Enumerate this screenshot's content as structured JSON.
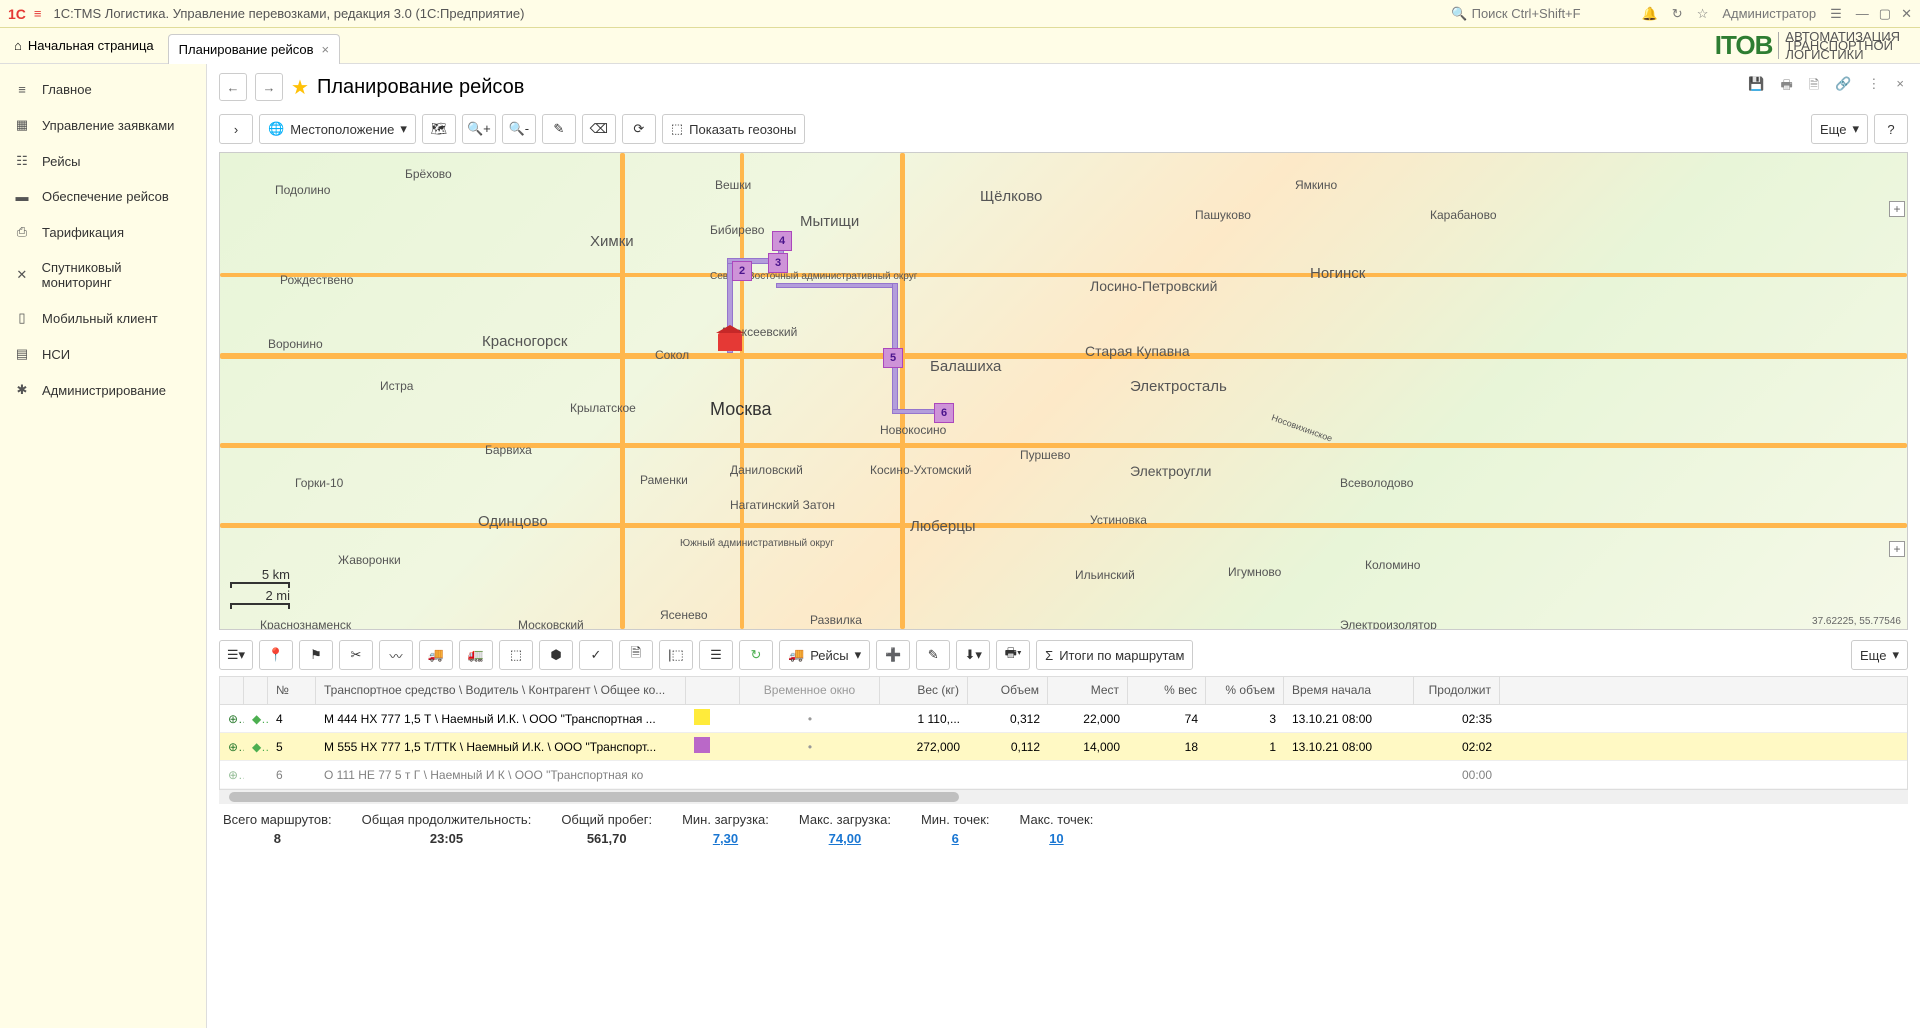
{
  "title": "1C:TMS Логистика. Управление перевозками, редакция 3.0  (1С:Предприятие)",
  "searchPlaceholder": "Поиск Ctrl+Shift+F",
  "user": "Администратор",
  "brand": {
    "main": "ITOB",
    "sub1": "АВТОМАТИЗАЦИЯ",
    "sub2": "ТРАНСПОРТНОЙ",
    "sub3": "ЛОГИСТИКИ"
  },
  "tabs": {
    "home": "Начальная страница",
    "active": "Планирование рейсов"
  },
  "nav": [
    "Главное",
    "Управление заявками",
    "Рейсы",
    "Обеспечение рейсов",
    "Тарификация",
    "Спутниковый мониторинг",
    "Мобильный клиент",
    "НСИ",
    "Администрирование"
  ],
  "navIcons": [
    "≡",
    "▦",
    "☷",
    "▬",
    "⎙",
    "✕",
    "▯",
    "▤",
    "✱"
  ],
  "page": {
    "title": "Планирование рейсов"
  },
  "tb1": {
    "location": "Местоположение",
    "geozones": "Показать геозоны",
    "more": "Еще",
    "help": "?"
  },
  "cities": {
    "moscow": "Москва",
    "podolino": "Подолино",
    "brekhovo": "Брёхово",
    "rozhdestveno": "Рождествено",
    "voronino": "Воронино",
    "istra": "Истра",
    "krasnogorsk": "Красногорск",
    "odintsovo": "Одинцово",
    "barvikha": "Барвиха",
    "krylatskoye": "Крылатское",
    "zhavoronki": "Жаворонки",
    "gorki": "Горки-10",
    "krasnoznamensk": "Краснознаменск",
    "moskovskiy": "Московский",
    "ramenki": "Раменки",
    "danilovskiy": "Даниловский",
    "nagatinsky": "Нагатинский Затон",
    "yuzhny": "Южный административный округ",
    "yasenevo": "Ясенево",
    "razvilka": "Развилка",
    "khimki": "Химки",
    "sokol": "Сокол",
    "biberevo": "Бибирево",
    "veshki": "Вешки",
    "mytishchi": "Мытищи",
    "alekseevsky": "Алексеевский",
    "vostochny": "Северо-Восточный административный округ",
    "balashikha": "Балашиха",
    "novokosino": "Новокосино",
    "lyubertsy": "Люберцы",
    "kosino": "Косино-Ухтомский",
    "shchelkovo": "Щёлково",
    "yamkino": "Ямкино",
    "pashukovo": "Пашуково",
    "losino": "Лосино-Петровский",
    "kupavna": "Старая Купавна",
    "elektrostal": "Электросталь",
    "elektrougli": "Электроугли",
    "ustinovka": "Устиновка",
    "ilinskiy": "Ильинский",
    "noginsk": "Ногинск",
    "karabanovo": "Карабаново",
    "igumnovo": "Игумново",
    "kolomino": "Коломино",
    "vsevolodovo": "Всеволодово",
    "nosovikh": "Носовихинское",
    "purshevo": "Пуршево",
    "elektroizol": "Электроизолятор"
  },
  "scale": {
    "km": "5 km",
    "mi": "2 mi"
  },
  "coords": "37.62225, 55.77546",
  "tb2": {
    "routes": "Рейсы",
    "totals": "Итоги по маршрутам",
    "more": "Еще"
  },
  "cols": {
    "no": "№",
    "ts": "Транспортное средство \\ Водитель \\ Контрагент \\ Общее ко...",
    "tw": "Временное окно",
    "wt": "Вес (кг)",
    "vol": "Объем",
    "pl": "Мест",
    "pw": "% вес",
    "pv": "% объем",
    "time": "Время начала",
    "dur": "Продолжит"
  },
  "rows": [
    {
      "no": "4",
      "ts": "М 444 НХ 777  1,5 Т  \\ Наемный И.К. \\ ООО \"Транспортная ...",
      "col": "#ffeb3b",
      "wt": "1 110,...",
      "vol": "0,312",
      "pl": "22,000",
      "pw": "74",
      "pv": "3",
      "time": "13.10.21 08:00",
      "dur": "02:35"
    },
    {
      "no": "5",
      "ts": "М 555 НХ 777  1,5 Т/ТТК \\ Наемный И.К. \\ ООО \"Транспорт...",
      "col": "#ba68c8",
      "wt": "272,000",
      "vol": "0,112",
      "pl": "14,000",
      "pw": "18",
      "pv": "1",
      "time": "13.10.21 08:00",
      "dur": "02:02"
    },
    {
      "no": "6",
      "ts": "О 111 НЕ 77 5 т  Г \\ Наемный И К \\ ООО \"Транспортная ко",
      "col": "",
      "wt": "",
      "vol": "",
      "pl": "",
      "pw": "",
      "pv": "",
      "time": "",
      "dur": "00:00"
    }
  ],
  "footer": {
    "l1": "Всего маршрутов:",
    "v1": "8",
    "l2": "Общая продолжительность:",
    "v2": "23:05",
    "l3": "Общий пробег:",
    "v3": "561,70",
    "l4": "Мин. загрузка:",
    "v4": "7,30",
    "l5": "Макс. загрузка:",
    "v5": "74,00",
    "l6": "Мин. точек:",
    "v6": "6",
    "l7": "Макс. точек:",
    "v7": "10"
  }
}
